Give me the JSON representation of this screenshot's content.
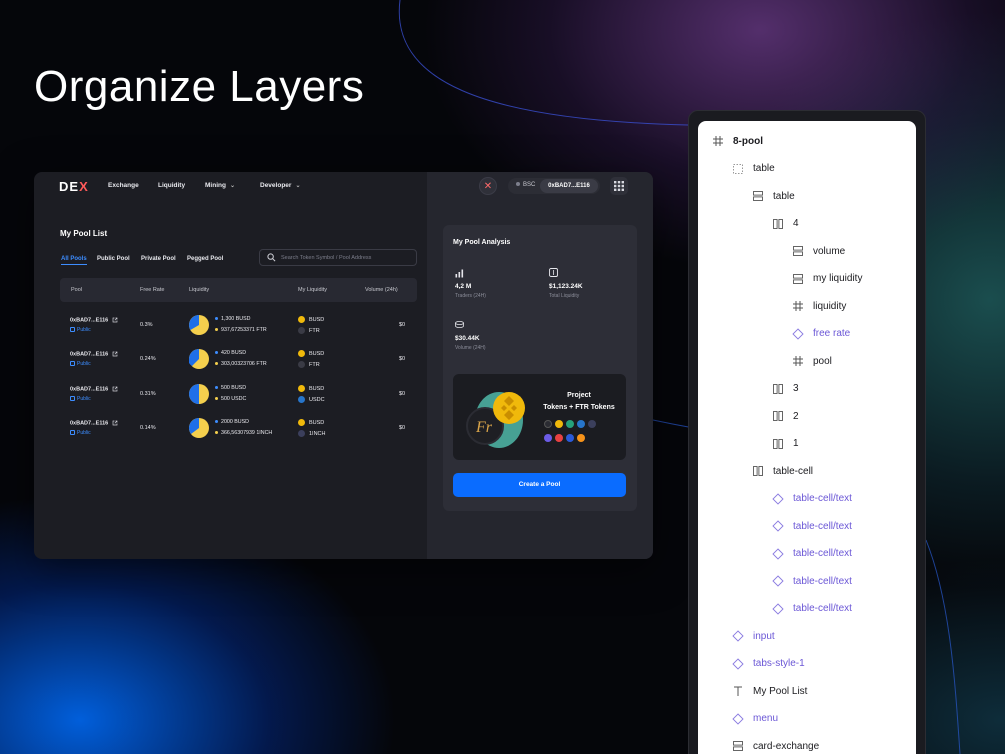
{
  "headline": "Organize Layers",
  "app": {
    "logo": {
      "text": "DE",
      "accent": "X"
    },
    "nav": [
      {
        "label": "Exchange",
        "dropdown": false
      },
      {
        "label": "Liquidity",
        "dropdown": false
      },
      {
        "label": "Mining",
        "dropdown": true
      },
      {
        "label": "Developer",
        "dropdown": true
      }
    ],
    "network": "BSC",
    "wallet_address": "0xBAD7...E116",
    "pool_list": {
      "title": "My Pool List",
      "tabs": [
        "All Pools",
        "Public Pool",
        "Private Pool",
        "Pegged Pool"
      ],
      "active_tab": "All Pools",
      "search_placeholder": "Search Token Symbol / Pool Address",
      "columns": [
        "Pool",
        "Free Rate",
        "Liquidity",
        "My Liquidity",
        "Volume (24h)"
      ],
      "rows": [
        {
          "pool": "0xBAD7...E116",
          "visibility": "Public",
          "rate": "0.3%",
          "liq1": "1,300 BUSD",
          "liq2": "937,67253371 FTR",
          "tok1": "BUSD",
          "tok2": "FTR",
          "volume": "$0"
        },
        {
          "pool": "0xBAD7...E116",
          "visibility": "Public",
          "rate": "0.24%",
          "liq1": "420 BUSD",
          "liq2": "303,00323706 FTR",
          "tok1": "BUSD",
          "tok2": "FTR",
          "volume": "$0"
        },
        {
          "pool": "0xBAD7...E116",
          "visibility": "Public",
          "rate": "0.31%",
          "liq1": "500 BUSD",
          "liq2": "500 USDC",
          "tok1": "BUSD",
          "tok2": "USDC",
          "volume": "$0"
        },
        {
          "pool": "0xBAD7...E116",
          "visibility": "Public",
          "rate": "0.14%",
          "liq1": "2000 BUSD",
          "liq2": "366,56307939 1INCH",
          "tok1": "BUSD",
          "tok2": "1INCH",
          "volume": "$0"
        }
      ]
    },
    "analysis": {
      "title": "My Pool Analysis",
      "stats": [
        {
          "icon": "bar-chart-icon",
          "value": "4,2 M",
          "label": "Traders (24H)"
        },
        {
          "icon": "dollar-box-icon",
          "value": "$1,123.24K",
          "label": "Total Liquidity"
        },
        {
          "icon": "coins-icon",
          "value": "$30.44K",
          "label": "Volume (24H)"
        }
      ],
      "promo": {
        "line1": "Project",
        "line2": "Tokens + FTR Tokens"
      },
      "create_button": "Create a Pool"
    }
  },
  "layers": [
    {
      "name": "8-pool",
      "icon": "frame-icon",
      "purple": false,
      "bold": true
    },
    {
      "name": "table",
      "icon": "dotted-frame-icon",
      "purple": false,
      "bold": false
    },
    {
      "name": "table",
      "icon": "rows-icon",
      "purple": false,
      "bold": false
    },
    {
      "name": "4",
      "icon": "columns-icon",
      "purple": false,
      "bold": false
    },
    {
      "name": "volume",
      "icon": "rows-icon",
      "purple": false,
      "bold": false
    },
    {
      "name": "my liquidity",
      "icon": "rows-icon",
      "purple": false,
      "bold": false
    },
    {
      "name": "liquidity",
      "icon": "frame-icon",
      "purple": false,
      "bold": false
    },
    {
      "name": "free rate",
      "icon": "component-icon",
      "purple": true,
      "bold": false
    },
    {
      "name": "pool",
      "icon": "frame-icon",
      "purple": false,
      "bold": false
    },
    {
      "name": "3",
      "icon": "columns-icon",
      "purple": false,
      "bold": false
    },
    {
      "name": "2",
      "icon": "columns-icon",
      "purple": false,
      "bold": false
    },
    {
      "name": "1",
      "icon": "columns-icon",
      "purple": false,
      "bold": false
    },
    {
      "name": "table-cell",
      "icon": "columns-icon",
      "purple": false,
      "bold": false
    },
    {
      "name": "table-cell/text",
      "icon": "component-icon",
      "purple": true,
      "bold": false
    },
    {
      "name": "table-cell/text",
      "icon": "component-icon",
      "purple": true,
      "bold": false
    },
    {
      "name": "table-cell/text",
      "icon": "component-icon",
      "purple": true,
      "bold": false
    },
    {
      "name": "table-cell/text",
      "icon": "component-icon",
      "purple": true,
      "bold": false
    },
    {
      "name": "table-cell/text",
      "icon": "component-icon",
      "purple": true,
      "bold": false
    },
    {
      "name": "input",
      "icon": "component-icon",
      "purple": true,
      "bold": false
    },
    {
      "name": "tabs-style-1",
      "icon": "component-icon",
      "purple": true,
      "bold": false
    },
    {
      "name": "My Pool List",
      "icon": "text-icon",
      "purple": false,
      "bold": false
    },
    {
      "name": "menu",
      "icon": "component-icon",
      "purple": true,
      "bold": false
    },
    {
      "name": "card-exchange",
      "icon": "rows-icon",
      "purple": false,
      "bold": false
    }
  ],
  "colors": {
    "accent_blue": "#0a6cff",
    "tab_active": "#3d8dff",
    "component_purple": "#6b57d6",
    "pie_blue": "#1f6fe8",
    "pie_yellow": "#f4cf4d",
    "busd_gold": "#f0b90b"
  }
}
